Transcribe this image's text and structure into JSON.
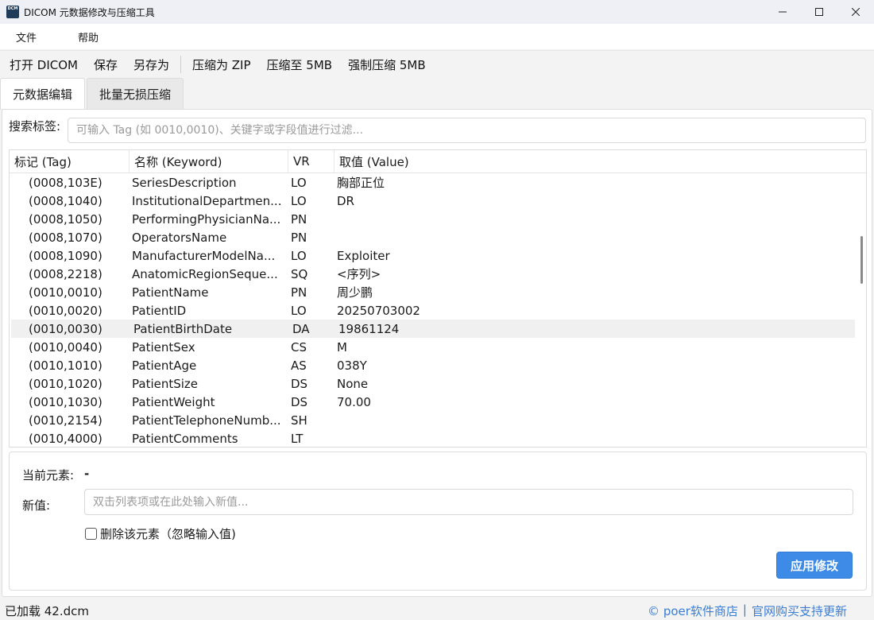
{
  "window": {
    "icon_text": "DCM",
    "title": "DICOM 元数据修改与压缩工具"
  },
  "menu": {
    "items": [
      {
        "label": "文件"
      },
      {
        "label": "帮助"
      }
    ]
  },
  "toolbar": {
    "open": "打开 DICOM",
    "save": "保存",
    "save_as": "另存为",
    "zip": "压缩为 ZIP",
    "compress_5mb": "压缩至 5MB",
    "force_5mb": "强制压缩 5MB"
  },
  "tabs": [
    {
      "label": "元数据编辑",
      "active": true
    },
    {
      "label": "批量无损压缩",
      "active": false
    }
  ],
  "search": {
    "label": "搜索标签:",
    "placeholder": "可输入 Tag (如 0010,0010)、关键字或字段值进行过滤..."
  },
  "table": {
    "headers": {
      "tag": "标记 (Tag)",
      "name": "名称 (Keyword)",
      "vr": "VR",
      "value": "取值 (Value)"
    },
    "selected_index": 8,
    "rows": [
      {
        "tag": "(0008,103E)",
        "name": "SeriesDescription",
        "vr": "LO",
        "value": "胸部正位"
      },
      {
        "tag": "(0008,1040)",
        "name": "InstitutionalDepartmen...",
        "vr": "LO",
        "value": "DR"
      },
      {
        "tag": "(0008,1050)",
        "name": "PerformingPhysicianNa...",
        "vr": "PN",
        "value": ""
      },
      {
        "tag": "(0008,1070)",
        "name": "OperatorsName",
        "vr": "PN",
        "value": ""
      },
      {
        "tag": "(0008,1090)",
        "name": "ManufacturerModelNa...",
        "vr": "LO",
        "value": "Exploiter"
      },
      {
        "tag": "(0008,2218)",
        "name": "AnatomicRegionSeque...",
        "vr": "SQ",
        "value": "<序列>"
      },
      {
        "tag": "(0010,0010)",
        "name": "PatientName",
        "vr": "PN",
        "value": "周少鹏"
      },
      {
        "tag": "(0010,0020)",
        "name": "PatientID",
        "vr": "LO",
        "value": "20250703002"
      },
      {
        "tag": "(0010,0030)",
        "name": "PatientBirthDate",
        "vr": "DA",
        "value": "19861124"
      },
      {
        "tag": "(0010,0040)",
        "name": "PatientSex",
        "vr": "CS",
        "value": "M"
      },
      {
        "tag": "(0010,1010)",
        "name": "PatientAge",
        "vr": "AS",
        "value": "038Y"
      },
      {
        "tag": "(0010,1020)",
        "name": "PatientSize",
        "vr": "DS",
        "value": "None"
      },
      {
        "tag": "(0010,1030)",
        "name": "PatientWeight",
        "vr": "DS",
        "value": "70.00"
      },
      {
        "tag": "(0010,2154)",
        "name": "PatientTelephoneNumb...",
        "vr": "SH",
        "value": ""
      },
      {
        "tag": "(0010,4000)",
        "name": "PatientComments",
        "vr": "LT",
        "value": ""
      }
    ]
  },
  "editor": {
    "current_label": "当前元素:",
    "current_value": "-",
    "new_label": "新值:",
    "new_placeholder": "双击列表项或在此处输入新值...",
    "delete_label": "删除该元素（忽略输入值)",
    "delete_checked": false,
    "apply_label": "应用修改"
  },
  "status": {
    "loaded": "已加载 42.dcm",
    "store_link": "© poer软件商店",
    "separator": "|",
    "buy_link": "官网购买支持更新"
  },
  "colors": {
    "accent": "#3d8be6",
    "link": "#3a7ed4",
    "selected_row": "#f0f0f0"
  }
}
